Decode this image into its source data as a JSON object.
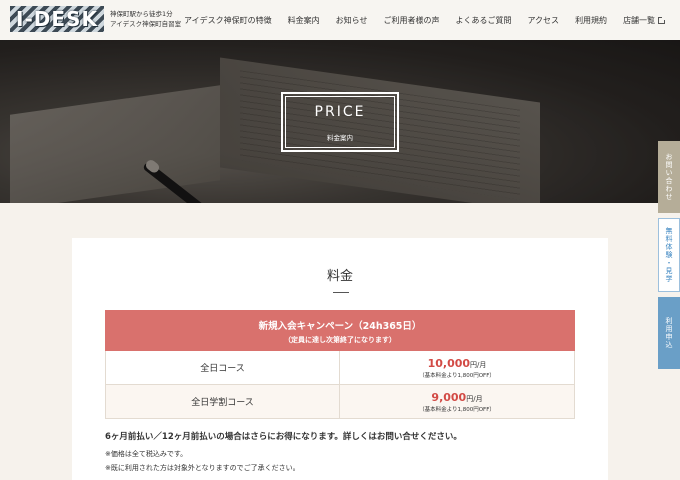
{
  "header": {
    "logo_text": "I-DESK",
    "tagline_line1": "神保町駅から徒歩1分",
    "tagline_line2": "アイデスク神保町自習室",
    "nav": [
      "アイデスク神保町の特徴",
      "料金案内",
      "お知らせ",
      "ご利用者様の声",
      "よくあるご質問",
      "アクセス",
      "利用規約",
      "店舗一覧"
    ]
  },
  "hero": {
    "title": "PRICE",
    "subtitle": "料金案内"
  },
  "side_tabs": {
    "contact": "お問い合わせ",
    "trial": "無料体験・見学",
    "apply": "利用申込"
  },
  "pricing": {
    "section_title": "料金",
    "campaign_title": "新規入会キャンペーン（24h365日）",
    "campaign_note": "（定員に達し次第終了になります）",
    "plans": [
      {
        "name": "全日コース",
        "price": "10,000",
        "unit": "円/月",
        "note": "（基本料金より1,800円OFF）"
      },
      {
        "name": "全日学割コース",
        "price": "9,000",
        "unit": "円/月",
        "note": "（基本料金より1,800円OFF）"
      }
    ],
    "lead": "6ヶ月前払い／12ヶ月前払いの場合はさらにお得になります。詳しくはお問い合せください。",
    "notes": [
      "※価格は全て税込みです。",
      "※既に利用された方は対象外となりますのでご了承ください。"
    ]
  },
  "colors": {
    "campaign_bg": "#d9716d",
    "price_red": "#d24a45",
    "tab_contact": "#b5ad98",
    "tab_apply": "#6a9fc7"
  }
}
